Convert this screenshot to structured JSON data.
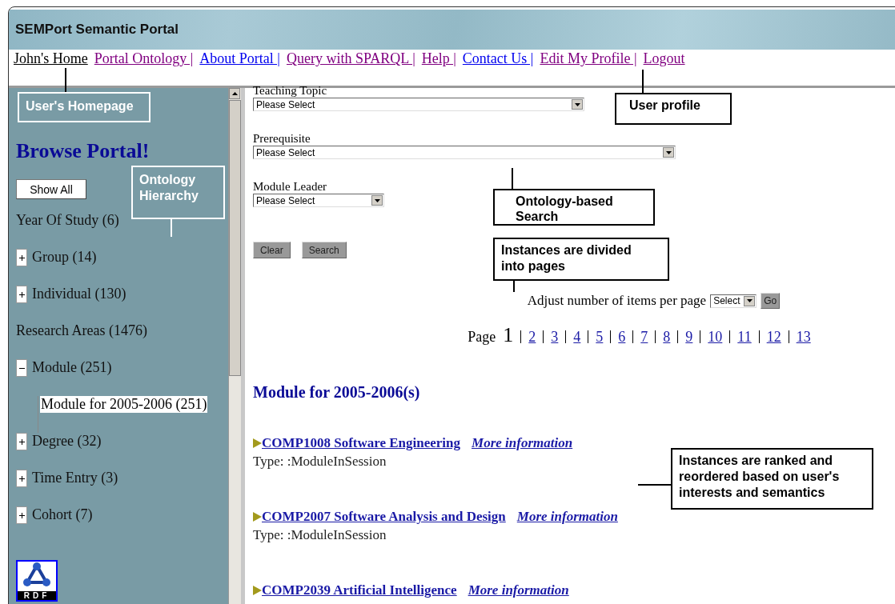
{
  "header": {
    "title": "SEMPort Semantic Portal"
  },
  "nav": [
    {
      "label": "John's Home",
      "kind": "current"
    },
    {
      "label": "Portal Ontology |",
      "kind": "visited"
    },
    {
      "label": "About Portal |",
      "kind": "link"
    },
    {
      "label": "Query with SPARQL |",
      "kind": "visited"
    },
    {
      "label": "Help |",
      "kind": "visited"
    },
    {
      "label": "Contact Us |",
      "kind": "link"
    },
    {
      "label": "Edit My Profile |",
      "kind": "visited"
    },
    {
      "label": "Logout",
      "kind": "visited"
    }
  ],
  "sidebar": {
    "heading": "Browse Portal!",
    "show_all": "Show All",
    "tree": [
      {
        "label": "Year Of Study (6)",
        "kind": "leaf"
      },
      {
        "label": "Group (14)",
        "kind": "toggle",
        "expanded": false
      },
      {
        "label": "Individual (130)",
        "kind": "toggle",
        "expanded": false
      },
      {
        "label": "Research Areas (1476)",
        "kind": "leaf"
      },
      {
        "label": "Module (251)",
        "kind": "toggle",
        "expanded": true,
        "children": [
          {
            "label": "Module for 2005-2006 (251)",
            "selected": true
          }
        ]
      },
      {
        "label": "Degree (32)",
        "kind": "toggle",
        "expanded": false
      },
      {
        "label": "Time Entry (3)",
        "kind": "toggle",
        "expanded": false
      },
      {
        "label": "Cohort (7)",
        "kind": "toggle",
        "expanded": false
      }
    ],
    "logo_text": "RDF"
  },
  "search": {
    "fields": [
      {
        "label": "Teaching Topic",
        "value": "Please Select"
      },
      {
        "label": "Prerequisite",
        "value": "Please Select"
      },
      {
        "label": "Module Leader",
        "value": "Please Select"
      }
    ],
    "buttons": [
      "Clear",
      "Search"
    ]
  },
  "per_page": {
    "label": "Adjust number of items per page",
    "value": "Select",
    "button": "Go"
  },
  "pagination": {
    "label": "Page",
    "pages": [
      {
        "label": "1",
        "selected": true
      },
      {
        "label": "2",
        "selected": false
      },
      {
        "label": "3",
        "selected": false
      },
      {
        "label": "4",
        "selected": false
      },
      {
        "label": "5",
        "selected": false
      },
      {
        "label": "6",
        "selected": false
      },
      {
        "label": "7",
        "selected": false
      },
      {
        "label": "8",
        "selected": false
      },
      {
        "label": "9",
        "selected": false
      },
      {
        "label": "10",
        "selected": false
      },
      {
        "label": "11",
        "selected": false
      },
      {
        "label": "12",
        "selected": false
      },
      {
        "label": "13",
        "selected": false
      }
    ]
  },
  "results": {
    "heading": "Module for 2005-2006(s)",
    "items": [
      {
        "title": "COMP1008 Software Engineering",
        "more": "More information",
        "type": "Type: :ModuleInSession"
      },
      {
        "title": "COMP2007 Software Analysis and Design",
        "more": "More information",
        "type": "Type: :ModuleInSession"
      },
      {
        "title": "COMP2039 Artificial Intelligence",
        "more": "More information"
      }
    ]
  },
  "annotations": [
    {
      "text": "User's Homepage",
      "kind": "inverse"
    },
    {
      "text": "Ontology Hierarchy",
      "kind": "inverse"
    },
    {
      "text": "User profile",
      "kind": "boxed"
    },
    {
      "text": "Ontology-based Search",
      "kind": "boxed"
    },
    {
      "text": "Instances are divided into pages",
      "kind": "boxed"
    },
    {
      "text": "Instances are ranked and reordered based on user's interests and semantics",
      "kind": "boxed"
    }
  ]
}
